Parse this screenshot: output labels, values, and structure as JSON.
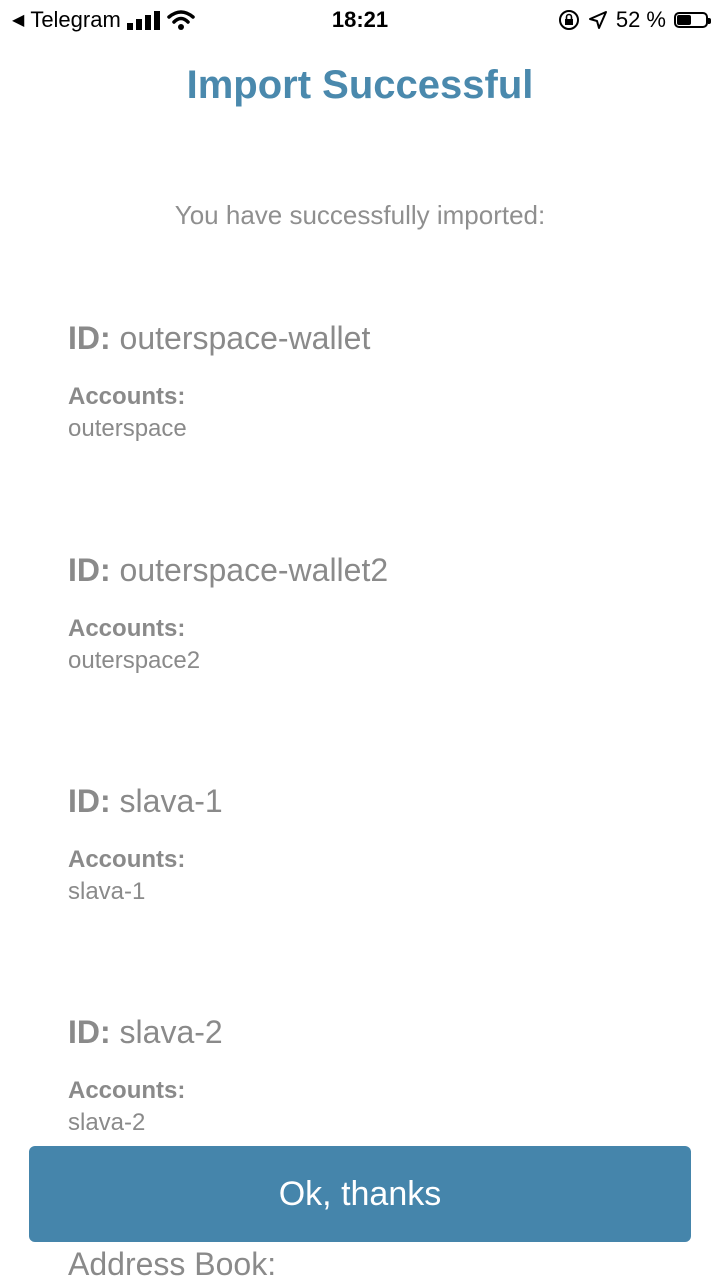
{
  "status_bar": {
    "back_app": "Telegram",
    "time": "18:21",
    "battery": "52 %",
    "battery_level": 0.52
  },
  "header": {
    "title": "Import Successful",
    "subtitle": "You have successfully imported:"
  },
  "wallets": [
    {
      "id_label": "ID:",
      "id": "outerspace-wallet",
      "accounts_label": "Accounts:",
      "accounts": "outerspace"
    },
    {
      "id_label": "ID:",
      "id": "outerspace-wallet2",
      "accounts_label": "Accounts:",
      "accounts": "outerspace2"
    },
    {
      "id_label": "ID:",
      "id": "slava-1",
      "accounts_label": "Accounts:",
      "accounts": "slava-1"
    },
    {
      "id_label": "ID:",
      "id": "slava-2",
      "accounts_label": "Accounts:",
      "accounts": "slava-2"
    }
  ],
  "address_book_label": "Address Book:",
  "ok_button_label": "Ok, thanks",
  "colors": {
    "accent": "#4a89ad",
    "button": "#4585ab",
    "text_gray": "#8a8a8a"
  }
}
